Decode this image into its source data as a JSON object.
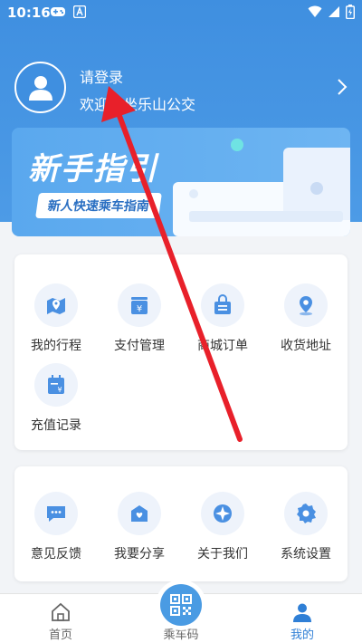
{
  "status_bar": {
    "time": "10:16"
  },
  "profile": {
    "login_label": "请登录",
    "welcome_text": "欢迎乘坐乐山公交"
  },
  "banner": {
    "title": "新手指引",
    "subtitle": "新人快速乘车指南"
  },
  "menu1": {
    "items": [
      {
        "label": "我的行程",
        "icon": "map-pin-icon"
      },
      {
        "label": "支付管理",
        "icon": "wallet-icon"
      },
      {
        "label": "商城订单",
        "icon": "shopping-bag-icon"
      },
      {
        "label": "收货地址",
        "icon": "location-icon"
      },
      {
        "label": "充值记录",
        "icon": "calendar-yen-icon"
      }
    ]
  },
  "menu2": {
    "items": [
      {
        "label": "意见反馈",
        "icon": "chat-icon"
      },
      {
        "label": "我要分享",
        "icon": "share-icon"
      },
      {
        "label": "关于我们",
        "icon": "compass-icon"
      },
      {
        "label": "系统设置",
        "icon": "gear-icon"
      }
    ]
  },
  "tabbar": {
    "tabs": [
      {
        "label": "首页",
        "icon": "home-icon"
      },
      {
        "label": "乘车码",
        "icon": "qr-code-icon"
      },
      {
        "label": "我的",
        "icon": "user-icon"
      }
    ]
  },
  "colors": {
    "primary": "#3f8fe0",
    "active_tab": "#2f7fd6",
    "arrow": "#e8202a"
  }
}
